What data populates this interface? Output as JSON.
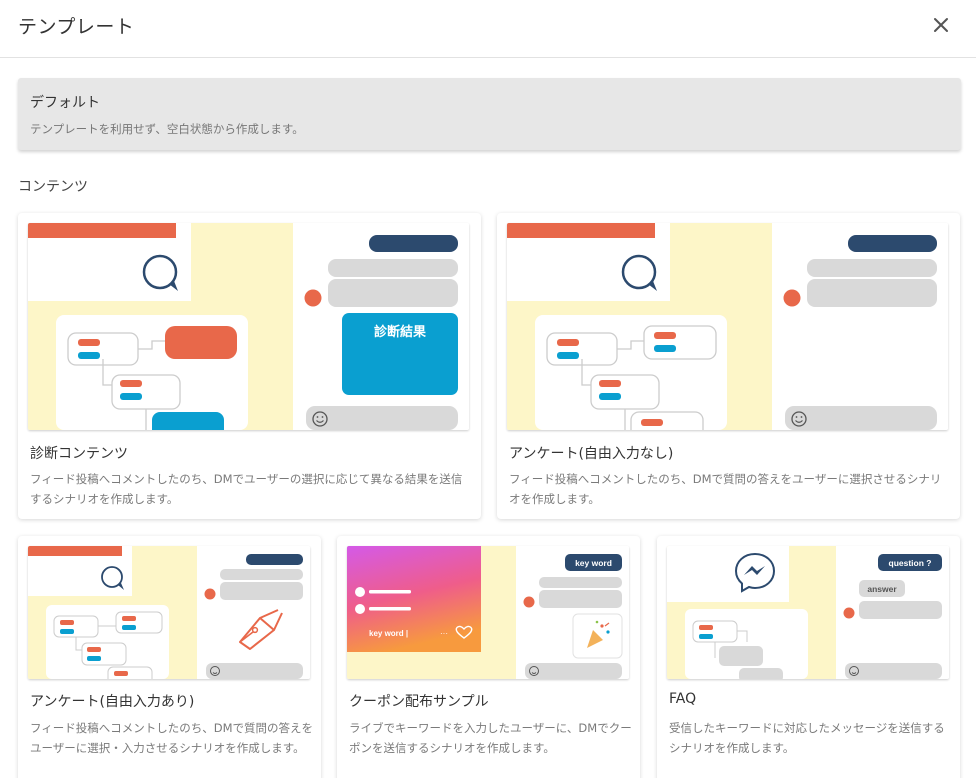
{
  "header": {
    "title": "テンプレート"
  },
  "default": {
    "title": "デフォルト",
    "description": "テンプレートを利用せず、空白状態から作成します。"
  },
  "section": {
    "label": "コンテンツ"
  },
  "cards": [
    {
      "title": "診断コンテンツ",
      "description": "フィード投稿へコメントしたのち、DMでユーザーの選択に応じて異なる結果を送信するシナリオを作成します。",
      "thumb_text": "診断結果"
    },
    {
      "title": "アンケート(自由入力なし)",
      "description": "フィード投稿へコメントしたのち、DMで質問の答えをユーザーに選択させるシナリオを作成します。"
    },
    {
      "title": "アンケート(自由入力あり)",
      "description": "フィード投稿へコメントしたのち、DMで質問の答えをユーザーに選択・入力させるシナリオを作成します。"
    },
    {
      "title": "クーポン配布サンプル",
      "description": "ライブでキーワードを入力したユーザーに、DMでクーポンを送信するシナリオを作成します。",
      "thumb_keyword_bubble": "key word",
      "thumb_keyword_input": "key word |",
      "thumb_dots": "···"
    },
    {
      "title": "FAQ",
      "description": "受信したキーワードに対応したメッセージを送信するシナリオを作成します。",
      "thumb_question": "question ?",
      "thumb_answer": "answer"
    }
  ],
  "colors": {
    "orange": "#e8684a",
    "navy": "#2c4a6e",
    "cyan": "#0a9fd0",
    "cream": "#fdf6c8",
    "gray_bubble": "#d9d9d9"
  },
  "icons": [
    "close-icon",
    "chat-bubble-icon",
    "smiley-icon",
    "pen-nib-icon",
    "heart-icon",
    "party-popper-icon",
    "messenger-icon"
  ]
}
